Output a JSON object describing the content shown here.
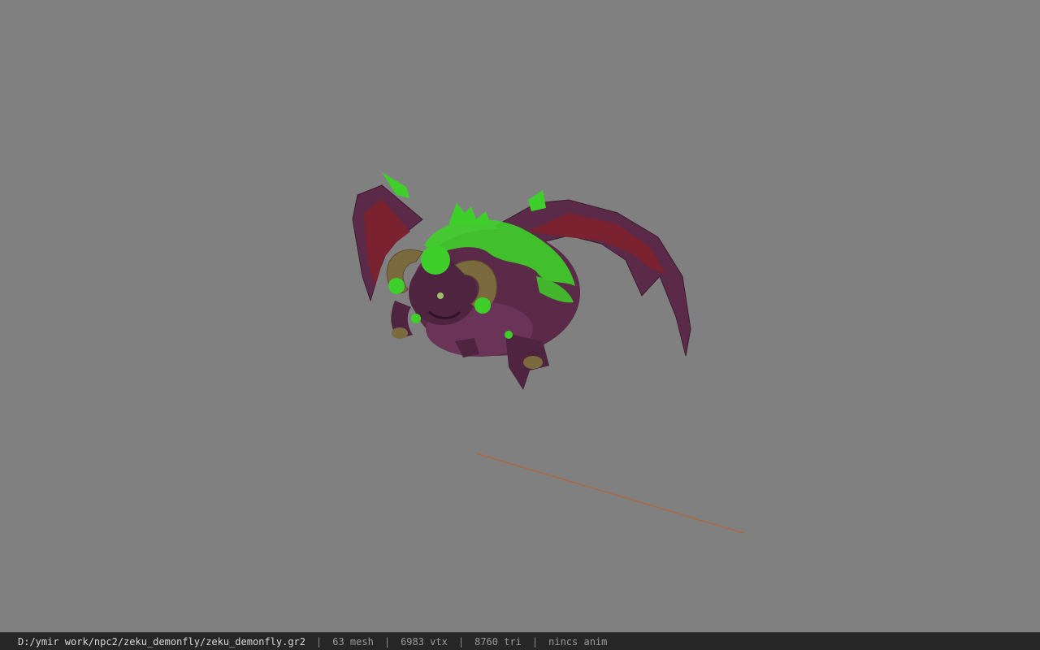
{
  "viewport": {
    "background_color": "#808080",
    "model_name": "demon-fly-creature",
    "model_colors": {
      "body": "#5a2a48",
      "wing_membrane": "#7a2230",
      "slime_glow": "#3fcf2a",
      "horn": "#7a6a3e"
    },
    "ground_line_color": "#c0602a"
  },
  "status_bar": {
    "file_path": "D:/ymir work/npc2/zeku_demonfly/zeku_demonfly.gr2",
    "mesh_count": "63 mesh",
    "vertex_count": "6983 vtx",
    "triangle_count": "8760 tri",
    "animation": "nincs anim",
    "separator": "|"
  }
}
